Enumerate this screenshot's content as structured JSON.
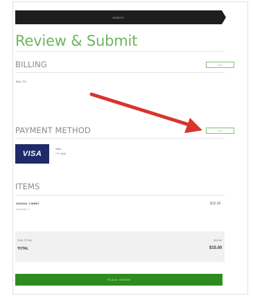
{
  "checkout": {
    "step_label": "VERIFY",
    "title": "Review & Submit"
  },
  "billing": {
    "label": "BILLING",
    "edit_label": "EDIT",
    "bill_to": "BILL TO"
  },
  "payment": {
    "label": "PAYMENT METHOD",
    "edit_label": "EDIT",
    "card_brand": "VISA",
    "card_name": "Visa",
    "card_number": "**** 1111"
  },
  "items": {
    "label": "ITEMS",
    "list": [
      {
        "name": "SCHOOL T-SHIRT",
        "quantity": "Quantity: 1",
        "price": "$15.00"
      }
    ]
  },
  "summary": {
    "subtotal_label": "SUB TOTAL",
    "subtotal_value": "$15.00",
    "total_label": "TOTAL",
    "total_value": "$15.00"
  },
  "actions": {
    "place_order_label": "PLACE ORDER"
  },
  "colors": {
    "accent": "#6cb65a",
    "header_bar": "#1e1e1e",
    "card": "#1f2a6b",
    "place_order": "#2e8b1e",
    "arrow": "#d9342b"
  }
}
